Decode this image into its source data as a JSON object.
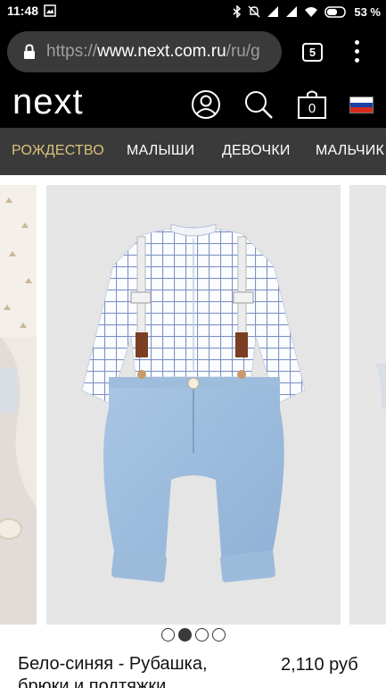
{
  "status_bar": {
    "time": "11:48",
    "battery_percent": "53 %"
  },
  "browser": {
    "url_scheme": "https://",
    "url_host": "www.next.com.ru",
    "url_path": "/ru/g",
    "tab_count": "5"
  },
  "header": {
    "logo": "next",
    "icons": [
      "account-icon",
      "search-icon",
      "bag-icon",
      "country-flag-ru"
    ],
    "bag_count": "0"
  },
  "nav": {
    "items": [
      {
        "label": "РОЖДЕСТВО",
        "active": true
      },
      {
        "label": "МАЛЫШИ",
        "active": false
      },
      {
        "label": "ДЕВОЧКИ",
        "active": false
      },
      {
        "label": "МАЛЬЧИК",
        "active": false
      }
    ]
  },
  "product": {
    "title": "Бело-синяя - Рубашка, брюки и подтяжки...",
    "price": "2,110 руб",
    "image_count": 4,
    "active_image": 2
  },
  "colors": {
    "nav_active": "#d9c27a",
    "nav_bg": "#3a3a3a",
    "header_bg": "#000000"
  }
}
